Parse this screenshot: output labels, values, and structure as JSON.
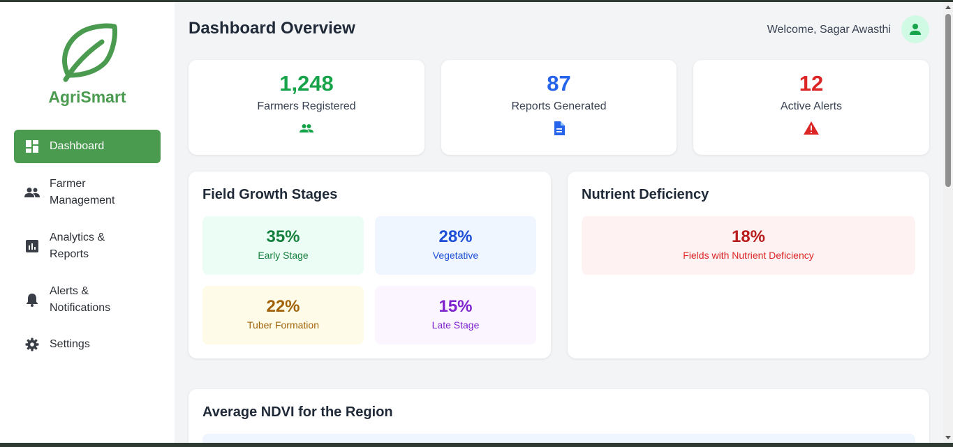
{
  "app": {
    "brand": "AgriSmart",
    "accent_color": "#4a9b4f",
    "logo_icon": "leaf-icon"
  },
  "sidebar": {
    "items": [
      {
        "label": "Dashboard",
        "icon": "dashboard-icon",
        "active": true
      },
      {
        "label": "Farmer Management",
        "icon": "people-icon",
        "active": false
      },
      {
        "label": "Analytics & Reports",
        "icon": "analytics-icon",
        "active": false
      },
      {
        "label": "Alerts & Notifications",
        "icon": "bell-icon",
        "active": false
      },
      {
        "label": "Settings",
        "icon": "gear-icon",
        "active": false
      }
    ]
  },
  "header": {
    "title": "Dashboard Overview",
    "welcome": "Welcome, Sagar Awasthi",
    "avatar_icon": "user-icon"
  },
  "stats": [
    {
      "value": "1,248",
      "label": "Farmers Registered",
      "icon": "people-icon",
      "color": "#16a34a"
    },
    {
      "value": "87",
      "label": "Reports Generated",
      "icon": "document-icon",
      "color": "#2563eb"
    },
    {
      "value": "12",
      "label": "Active Alerts",
      "icon": "warning-icon",
      "color": "#dc2626"
    }
  ],
  "growth": {
    "title": "Field Growth Stages",
    "stages": [
      {
        "value": "35%",
        "label": "Early Stage",
        "color": "#15803d",
        "bg": "#ecfdf5"
      },
      {
        "value": "28%",
        "label": "Vegetative",
        "color": "#1d4ed8",
        "bg": "#eff6ff"
      },
      {
        "value": "22%",
        "label": "Tuber Formation",
        "color": "#a16207",
        "bg": "#fefce8"
      },
      {
        "value": "15%",
        "label": "Late Stage",
        "color": "#7e22ce",
        "bg": "#faf5ff"
      }
    ]
  },
  "nutrient": {
    "title": "Nutrient Deficiency",
    "value": "18%",
    "label": "Fields with Nutrient Deficiency",
    "color": "#b91c1c",
    "bg": "#fef2f2"
  },
  "ndvi": {
    "title": "Average NDVI for the Region"
  }
}
